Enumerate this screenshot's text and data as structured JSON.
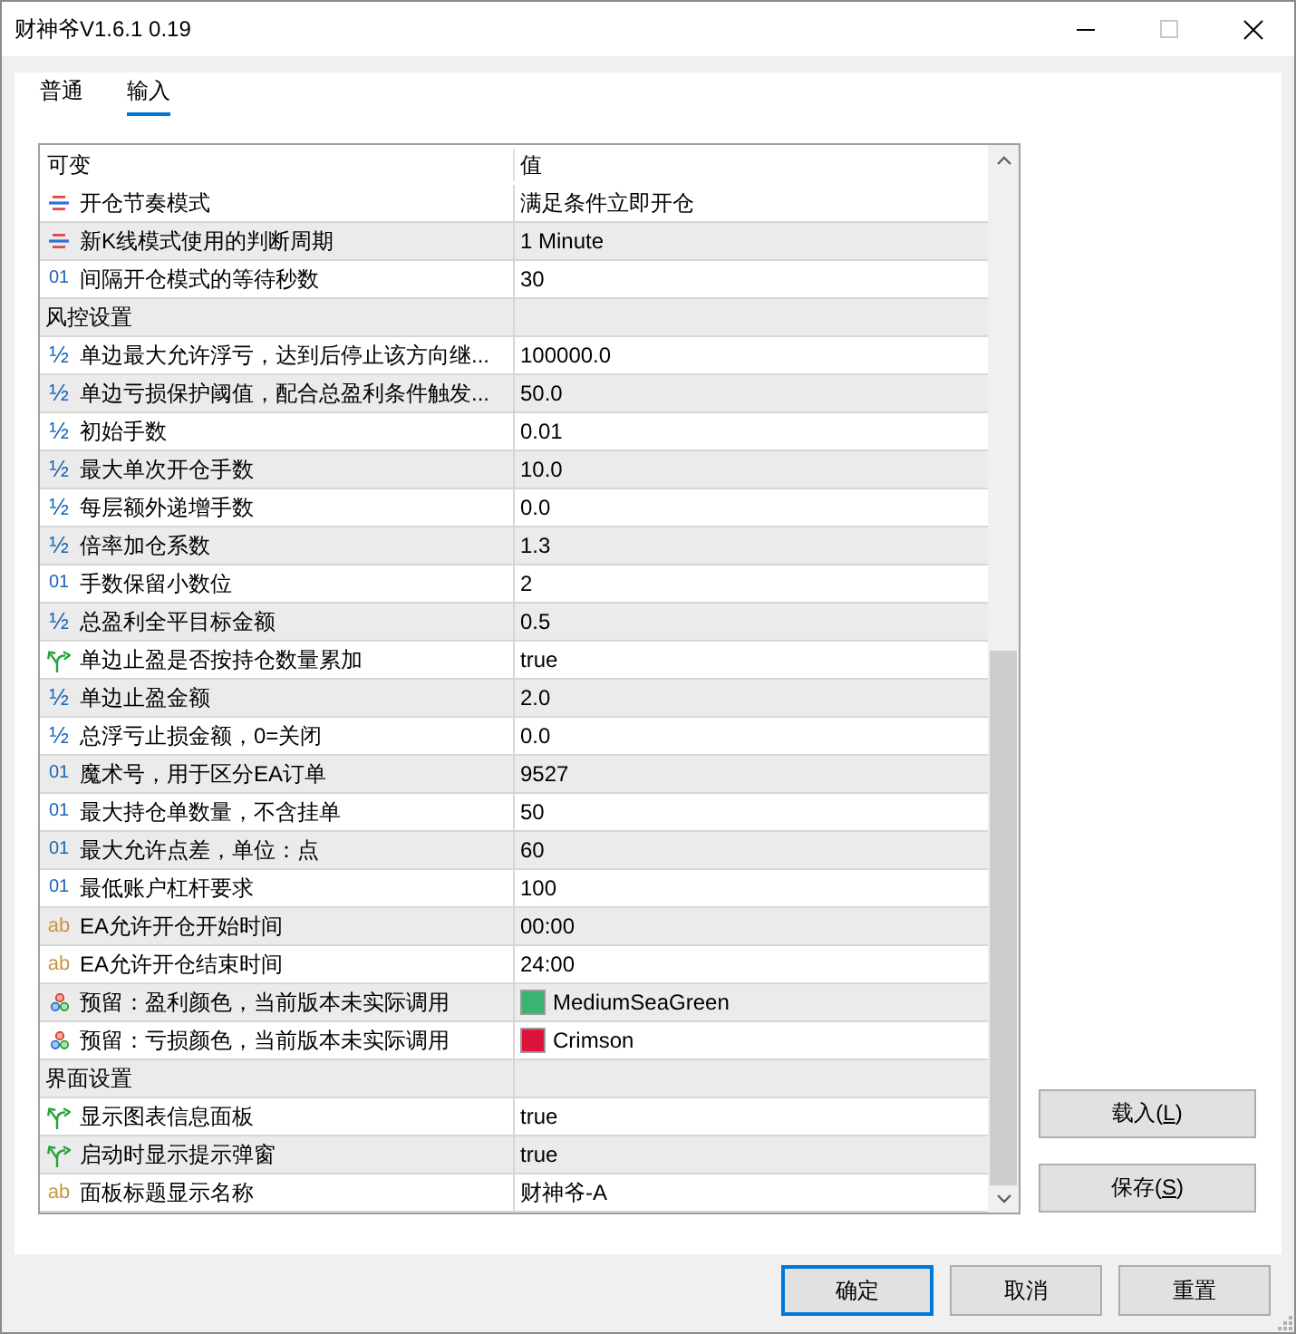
{
  "window": {
    "title": "财神爷V1.6.1 0.19",
    "maximize_disabled": true
  },
  "tabs": [
    {
      "label": "普通",
      "selected": false
    },
    {
      "label": "输入",
      "selected": true
    }
  ],
  "table": {
    "columns": [
      "可变",
      "值"
    ],
    "rows": [
      {
        "kind": "enum",
        "name": "开仓节奏模式",
        "value": "满足条件立即开仓"
      },
      {
        "kind": "enum",
        "name": "新K线模式使用的判断周期",
        "value": "1 Minute"
      },
      {
        "kind": "int",
        "icon": "01",
        "name": "间隔开仓模式的等待秒数",
        "value": "30"
      },
      {
        "kind": "group",
        "name": "风控设置"
      },
      {
        "kind": "double",
        "icon": "½",
        "name": "单边最大允许浮亏，达到后停止该方向继...",
        "value": "100000.0"
      },
      {
        "kind": "double",
        "icon": "½",
        "name": "单边亏损保护阈值，配合总盈利条件触发...",
        "value": "50.0"
      },
      {
        "kind": "double",
        "icon": "½",
        "name": "初始手数",
        "value": "0.01"
      },
      {
        "kind": "double",
        "icon": "½",
        "name": "最大单次开仓手数",
        "value": "10.0"
      },
      {
        "kind": "double",
        "icon": "½",
        "name": "每层额外递增手数",
        "value": "0.0"
      },
      {
        "kind": "double",
        "icon": "½",
        "name": "倍率加仓系数",
        "value": "1.3"
      },
      {
        "kind": "int",
        "icon": "01",
        "name": "手数保留小数位",
        "value": "2"
      },
      {
        "kind": "double",
        "icon": "½",
        "name": "总盈利全平目标金额",
        "value": "0.5"
      },
      {
        "kind": "bool",
        "name": "单边止盈是否按持仓数量累加",
        "value": "true"
      },
      {
        "kind": "double",
        "icon": "½",
        "name": "单边止盈金额",
        "value": "2.0"
      },
      {
        "kind": "double",
        "icon": "½",
        "name": "总浮亏止损金额，0=关闭",
        "value": "0.0"
      },
      {
        "kind": "int",
        "icon": "01",
        "name": "魔术号，用于区分EA订单",
        "value": "9527"
      },
      {
        "kind": "int",
        "icon": "01",
        "name": "最大持仓单数量，不含挂单",
        "value": "50"
      },
      {
        "kind": "int",
        "icon": "01",
        "name": "最大允许点差，单位：点",
        "value": "60"
      },
      {
        "kind": "int",
        "icon": "01",
        "name": "最低账户杠杆要求",
        "value": "100"
      },
      {
        "kind": "string",
        "icon": "ab",
        "name": "EA允许开仓开始时间",
        "value": "00:00"
      },
      {
        "kind": "string",
        "icon": "ab",
        "name": "EA允许开仓结束时间",
        "value": "24:00"
      },
      {
        "kind": "color",
        "name": "预留：盈利颜色，当前版本未实际调用",
        "value": "MediumSeaGreen",
        "color": "#3cb371"
      },
      {
        "kind": "color",
        "name": "预留：亏损颜色，当前版本未实际调用",
        "value": "Crimson",
        "color": "#dc143c"
      },
      {
        "kind": "group",
        "name": "界面设置"
      },
      {
        "kind": "bool",
        "name": "显示图表信息面板",
        "value": "true"
      },
      {
        "kind": "bool",
        "name": "启动时显示提示弹窗",
        "value": "true"
      },
      {
        "kind": "string",
        "icon": "ab",
        "name": "面板标题显示名称",
        "value": "财神爷-A"
      }
    ]
  },
  "side_buttons": [
    {
      "label": "载入(",
      "access_key": "L",
      "label_end": ")"
    },
    {
      "label": "保存(",
      "access_key": "S",
      "label_end": ")"
    }
  ],
  "buttons": [
    {
      "label": "确定",
      "default": true
    },
    {
      "label": "取消",
      "default": false
    },
    {
      "label": "重置",
      "default": false
    }
  ]
}
